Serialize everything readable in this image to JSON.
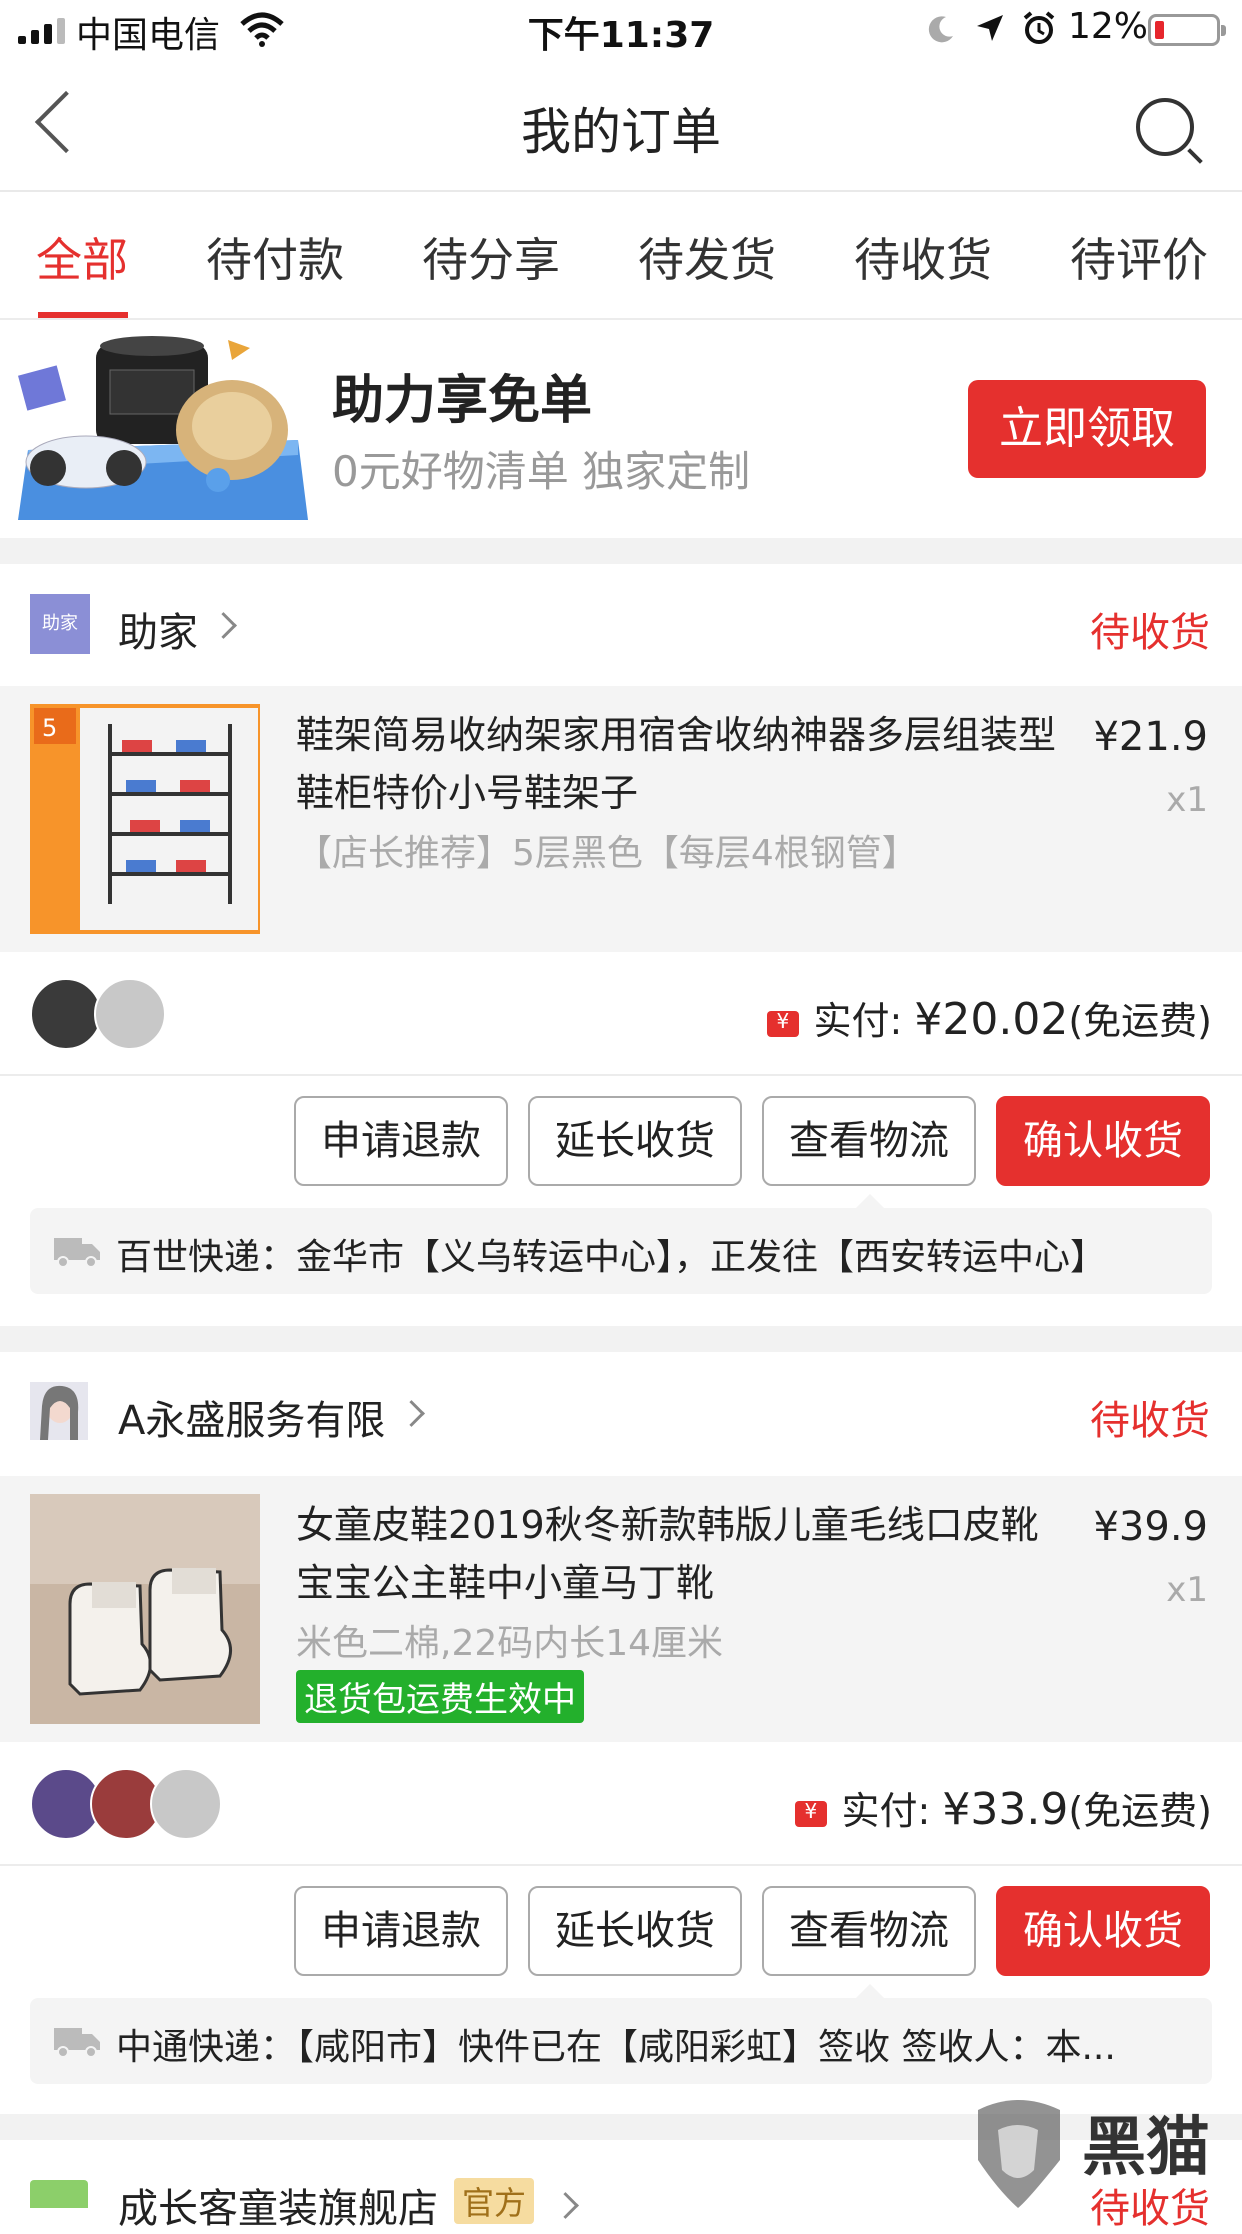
{
  "status_bar": {
    "carrier": "中国电信",
    "time": "下午11:37",
    "battery": "12%"
  },
  "nav": {
    "title": "我的订单"
  },
  "tabs": [
    {
      "label": "全部",
      "active": true
    },
    {
      "label": "待付款"
    },
    {
      "label": "待分享"
    },
    {
      "label": "待发货"
    },
    {
      "label": "待收货"
    },
    {
      "label": "待评价"
    }
  ],
  "banner": {
    "title": "助力享免单",
    "subtitle": "0元好物清单 独家定制",
    "button": "立即领取"
  },
  "orders": [
    {
      "shop_avatar_text": "助家",
      "shop_name": "助家",
      "status": "待收货",
      "item": {
        "title": "鞋架简易收纳架家用宿舍收纳神器多层组装型鞋柜特价小号鞋架子",
        "spec": "【店长推荐】5层黑色【每层4根钢管】",
        "price": "¥21.9",
        "qty": "x1"
      },
      "paid_label": "实付: ",
      "paid_amount": "¥20.02",
      "paid_note": "(免运费)",
      "buttons": [
        "申请退款",
        "延长收货",
        "查看物流",
        "确认收货"
      ],
      "logistics": "百世快递：金华市【义乌转运中心】，正发往【西安转运中心】"
    },
    {
      "shop_name": "A永盛服务有限",
      "status": "待收货",
      "item": {
        "title": "女童皮鞋2019秋冬新款韩版儿童毛线口皮靴宝宝公主鞋中小童马丁靴",
        "spec": "米色二棉,22码内长14厘米",
        "badge": "退货包运费生效中",
        "price": "¥39.9",
        "qty": "x1"
      },
      "paid_label": "实付: ",
      "paid_amount": "¥33.9",
      "paid_note": "(免运费)",
      "buttons": [
        "申请退款",
        "延长收货",
        "查看物流",
        "确认收货"
      ],
      "logistics": "中通快递：【咸阳市】快件已在【咸阳彩虹】签收 签收人：本..."
    },
    {
      "shop_name": "成长客童装旗舰店",
      "tag": "官方",
      "status": "待收货"
    }
  ],
  "watermark": "黑猫"
}
